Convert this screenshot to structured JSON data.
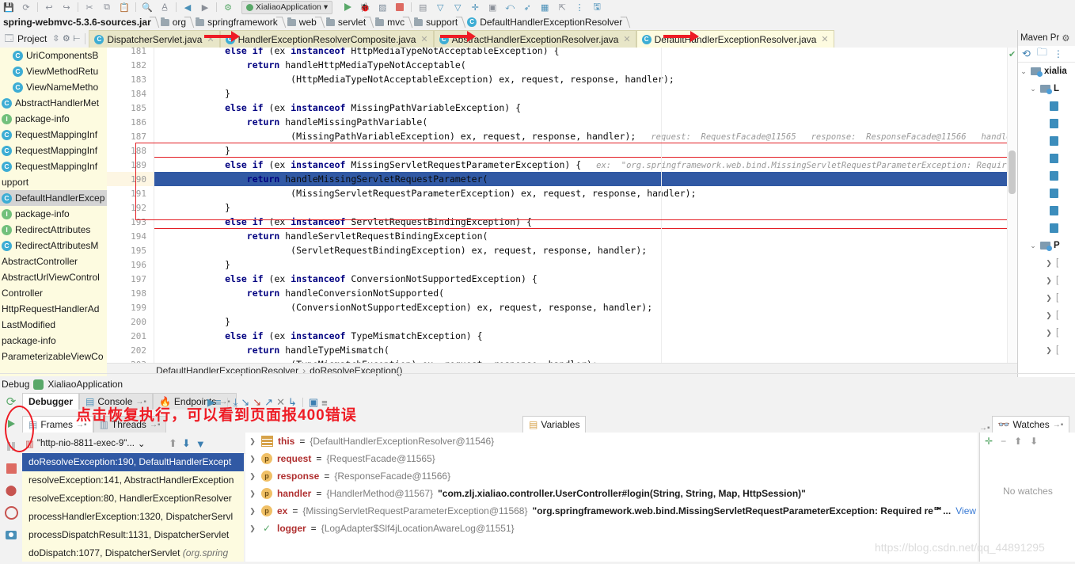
{
  "toolbar": {
    "icons": [
      "save-icon",
      "sync-icon",
      "undo-icon",
      "redo-icon",
      "cut-icon",
      "copy-icon",
      "paste-icon",
      "find-icon",
      "replace-icon",
      "back-icon",
      "forward-icon",
      "compile-icon"
    ],
    "run_config": "XialiaoApplication",
    "run_config_caret": "▾",
    "right_icons": [
      "run-icon",
      "debug-icon",
      "coverage-icon",
      "stop-icon",
      "profiler-icon",
      "filter1-icon",
      "filter2-icon",
      "pin-icon",
      "layout-icon",
      "revert-icon",
      "rocket-icon",
      "grid-icon",
      "export-icon",
      "more-icon",
      "save-all-icon"
    ]
  },
  "breadcrumb": {
    "items": [
      {
        "label": "spring-webmvc-5.3.6-sources.jar",
        "icon": "jar-icon"
      },
      {
        "label": "org",
        "icon": "folder-icon"
      },
      {
        "label": "springframework",
        "icon": "folder-icon"
      },
      {
        "label": "web",
        "icon": "folder-icon"
      },
      {
        "label": "servlet",
        "icon": "folder-icon"
      },
      {
        "label": "mvc",
        "icon": "folder-icon"
      },
      {
        "label": "support",
        "icon": "folder-icon"
      },
      {
        "label": "DefaultHandlerExceptionResolver",
        "icon": "class-icon"
      }
    ]
  },
  "project_button": {
    "label": "Project",
    "icons": [
      "project-icon",
      "collapse-all-icon",
      "settings-gear-icon",
      "hide-icon"
    ]
  },
  "editor_tabs": [
    {
      "label": "DispatcherServlet.java",
      "active": false
    },
    {
      "label": "HandlerExceptionResolverComposite.java",
      "active": false
    },
    {
      "label": "AbstractHandlerExceptionResolver.java",
      "active": false
    },
    {
      "label": "DefaultHandlerExceptionResolver.java",
      "active": true
    }
  ],
  "project_tree": [
    {
      "label": "UriComponentsB",
      "icon": "class-icon",
      "indent": 1,
      "selected": false
    },
    {
      "label": "ViewMethodRetu",
      "icon": "class-icon",
      "indent": 1,
      "selected": false
    },
    {
      "label": "ViewNameMetho",
      "icon": "class-icon",
      "indent": 1,
      "selected": false
    },
    {
      "label": "AbstractHandlerMet",
      "icon": "class-icon",
      "indent": 0,
      "selected": false
    },
    {
      "label": "package-info",
      "icon": "interface-icon",
      "indent": 0,
      "selected": false
    },
    {
      "label": "RequestMappingInf",
      "icon": "class-icon",
      "indent": 0,
      "selected": false
    },
    {
      "label": "RequestMappingInf",
      "icon": "class-icon",
      "indent": 0,
      "selected": false
    },
    {
      "label": "RequestMappingInf",
      "icon": "class-icon",
      "indent": 0,
      "selected": false
    },
    {
      "label": "upport",
      "icon": "none",
      "indent": 0,
      "selected": false
    },
    {
      "label": "DefaultHandlerExcep",
      "icon": "class-icon",
      "indent": 0,
      "selected": true
    },
    {
      "label": "package-info",
      "icon": "interface-icon",
      "indent": 0,
      "selected": false
    },
    {
      "label": "RedirectAttributes",
      "icon": "interface-icon",
      "indent": 0,
      "selected": false
    },
    {
      "label": "RedirectAttributesM",
      "icon": "class-icon",
      "indent": 0,
      "selected": false
    },
    {
      "label": "AbstractController",
      "icon": "none",
      "indent": 0,
      "selected": false
    },
    {
      "label": "AbstractUrlViewControl",
      "icon": "none",
      "indent": 0,
      "selected": false
    },
    {
      "label": "Controller",
      "icon": "none",
      "indent": 0,
      "selected": false
    },
    {
      "label": "HttpRequestHandlerAd",
      "icon": "none",
      "indent": 0,
      "selected": false
    },
    {
      "label": "LastModified",
      "icon": "none",
      "indent": 0,
      "selected": false
    },
    {
      "label": "package-info",
      "icon": "none",
      "indent": 0,
      "selected": false
    },
    {
      "label": "ParameterizableViewCo",
      "icon": "none",
      "indent": 0,
      "selected": false
    }
  ],
  "code": {
    "first_line": 181,
    "highlighted_line": 190,
    "lines": [
      {
        "n": 181,
        "text": "\t\t\telse if (ex instanceof HttpMediaTypeNotAcceptableException) {",
        "kw": [
          "else",
          "if",
          "instanceof"
        ]
      },
      {
        "n": 182,
        "text": "\t\t\t\treturn handleHttpMediaTypeNotAcceptable(",
        "kw": [
          "return"
        ]
      },
      {
        "n": 183,
        "text": "\t\t\t\t\t\t(HttpMediaTypeNotAcceptableException) ex, request, response, handler);",
        "kw": []
      },
      {
        "n": 184,
        "text": "\t\t\t}",
        "kw": []
      },
      {
        "n": 185,
        "text": "\t\t\telse if (ex instanceof MissingPathVariableException) {",
        "kw": [
          "else",
          "if",
          "instanceof"
        ]
      },
      {
        "n": 186,
        "text": "\t\t\t\treturn handleMissingPathVariable(",
        "kw": [
          "return"
        ]
      },
      {
        "n": 187,
        "text": "\t\t\t\t\t\t(MissingPathVariableException) ex, request, response, handler);",
        "kw": [],
        "hint": "request:  RequestFacade@11565   response:  ResponseFacade@11566   handler:  \"com.zlj.xialiao.cont"
      },
      {
        "n": 188,
        "text": "\t\t\t}",
        "kw": []
      },
      {
        "n": 189,
        "text": "\t\t\telse if (ex instanceof MissingServletRequestParameterException) {",
        "kw": [
          "else",
          "if",
          "instanceof"
        ],
        "hint": "ex:  \"org.springframework.web.bind.MissingServletRequestParameterException: Required request paramete"
      },
      {
        "n": 190,
        "text": "\t\t\t\treturn handleMissingServletRequestParameter(",
        "kw": [
          "return"
        ]
      },
      {
        "n": 191,
        "text": "\t\t\t\t\t\t(MissingServletRequestParameterException) ex, request, response, handler);",
        "kw": []
      },
      {
        "n": 192,
        "text": "\t\t\t}",
        "kw": []
      },
      {
        "n": 193,
        "text": "\t\t\telse if (ex instanceof ServletRequestBindingException) {",
        "kw": [
          "else",
          "if",
          "instanceof"
        ]
      },
      {
        "n": 194,
        "text": "\t\t\t\treturn handleServletRequestBindingException(",
        "kw": [
          "return"
        ]
      },
      {
        "n": 195,
        "text": "\t\t\t\t\t\t(ServletRequestBindingException) ex, request, response, handler);",
        "kw": []
      },
      {
        "n": 196,
        "text": "\t\t\t}",
        "kw": []
      },
      {
        "n": 197,
        "text": "\t\t\telse if (ex instanceof ConversionNotSupportedException) {",
        "kw": [
          "else",
          "if",
          "instanceof"
        ]
      },
      {
        "n": 198,
        "text": "\t\t\t\treturn handleConversionNotSupported(",
        "kw": [
          "return"
        ]
      },
      {
        "n": 199,
        "text": "\t\t\t\t\t\t(ConversionNotSupportedException) ex, request, response, handler);",
        "kw": []
      },
      {
        "n": 200,
        "text": "\t\t\t}",
        "kw": []
      },
      {
        "n": 201,
        "text": "\t\t\telse if (ex instanceof TypeMismatchException) {",
        "kw": [
          "else",
          "if",
          "instanceof"
        ]
      },
      {
        "n": 202,
        "text": "\t\t\t\treturn handleTypeMismatch(",
        "kw": [
          "return"
        ]
      },
      {
        "n": 203,
        "text": "\t\t\t\t\t\t(TypeMismatchException) ex, request, response, handler);",
        "kw": []
      }
    ]
  },
  "editor_footer": {
    "class_name": "DefaultHandlerExceptionResolver",
    "separator": "›",
    "method_name": "doResolveException()"
  },
  "maven": {
    "title": "Maven Pr",
    "gear_icon": "gear-icon",
    "toolbar_icons": [
      "reload-icon",
      "add-module-icon",
      "more-icon"
    ],
    "root": "xialia",
    "nodes": [
      "L",
      "P"
    ]
  },
  "debug": {
    "window_title": "Debug",
    "config_name": "XialiaoApplication",
    "rail_icons": [
      "rerun-icon",
      "resume-icon",
      "pause-icon",
      "stop-icon",
      "breakpoints-icon",
      "mute-breakpoints-icon",
      "camera-icon"
    ],
    "tabs": [
      {
        "label": "Debugger",
        "icon": "debugger-icon",
        "active": true
      },
      {
        "label": "Console",
        "icon": "console-icon",
        "active": false
      },
      {
        "label": "Endpoints",
        "icon": "endpoints-icon",
        "active": false
      }
    ],
    "toolbar_icons": [
      "show-execution-point-icon",
      "step-over-icon",
      "step-into-icon",
      "force-step-into-icon",
      "step-out-icon",
      "drop-frame-icon",
      "run-to-cursor-icon",
      "evaluate-icon",
      "settings-icon"
    ],
    "subtabs": [
      {
        "label": "Frames",
        "icon": "frames-icon",
        "active": true
      },
      {
        "label": "Threads",
        "icon": "threads-icon",
        "active": false
      }
    ],
    "variables_tab": {
      "label": "Variables",
      "icon": "variables-icon"
    },
    "watches_tab": {
      "label": "Watches",
      "icon": "watches-icon"
    },
    "thread_selector": {
      "value": "\"http-nio-8811-exec-9\"...",
      "caret": "⌄",
      "icon": "thread-icon"
    },
    "frames_toolbar_icons": [
      "up-arrow-icon",
      "down-arrow-icon",
      "filter-icon"
    ],
    "frames": [
      {
        "label": "doResolveException:190, DefaultHandlerExcept",
        "pkg": "",
        "selected": true
      },
      {
        "label": "resolveException:141, AbstractHandlerException",
        "pkg": "",
        "selected": false
      },
      {
        "label": "resolveException:80, HandlerExceptionResolver",
        "pkg": "",
        "selected": false
      },
      {
        "label": "processHandlerException:1320, DispatcherServl",
        "pkg": "",
        "selected": false
      },
      {
        "label": "processDispatchResult:1131, DispatcherServlet",
        "pkg": "",
        "selected": false
      },
      {
        "label": "doDispatch:1077, DispatcherServlet ",
        "pkg": "(org.spring",
        "selected": false
      }
    ],
    "variables": [
      {
        "chevron": "❯",
        "icon": "this-icon",
        "name": "this",
        "eq": " = ",
        "value": "{DefaultHandlerExceptionResolver@11546}",
        "str": "",
        "link": ""
      },
      {
        "chevron": "❯",
        "icon": "param-icon",
        "name": "request",
        "eq": " = ",
        "value": "{RequestFacade@11565}",
        "str": "",
        "link": ""
      },
      {
        "chevron": "❯",
        "icon": "param-icon",
        "name": "response",
        "eq": " = ",
        "value": "{ResponseFacade@11566}",
        "str": "",
        "link": ""
      },
      {
        "chevron": "❯",
        "icon": "param-icon",
        "name": "handler",
        "eq": " = ",
        "value": "{HandlerMethod@11567}",
        "str": "\"com.zlj.xialiao.controller.UserController#login(String, String, Map, HttpSession)\"",
        "link": ""
      },
      {
        "chevron": "❯",
        "icon": "param-icon",
        "name": "ex",
        "eq": " = ",
        "value": "{MissingServletRequestParameterException@11568}",
        "str": "\"org.springframework.web.bind.MissingServletRequestParameterException: Required re℠...",
        "link": "View"
      },
      {
        "chevron": "❯",
        "icon": "logger-icon",
        "name": "logger",
        "eq": " = ",
        "value": "{LogAdapter$Slf4jLocationAwareLog@11551}",
        "str": "",
        "link": ""
      }
    ],
    "watches": {
      "toolbar_icons": [
        "add-watch-icon",
        "remove-watch-icon",
        "up-icon",
        "down-icon"
      ],
      "empty_text": "No watches"
    }
  },
  "annotation": {
    "text": "点击恢复执行，可以看到页面报400错误",
    "color": "#ee1c25"
  },
  "watermark": "https://blog.csdn.net/qq_44891295"
}
